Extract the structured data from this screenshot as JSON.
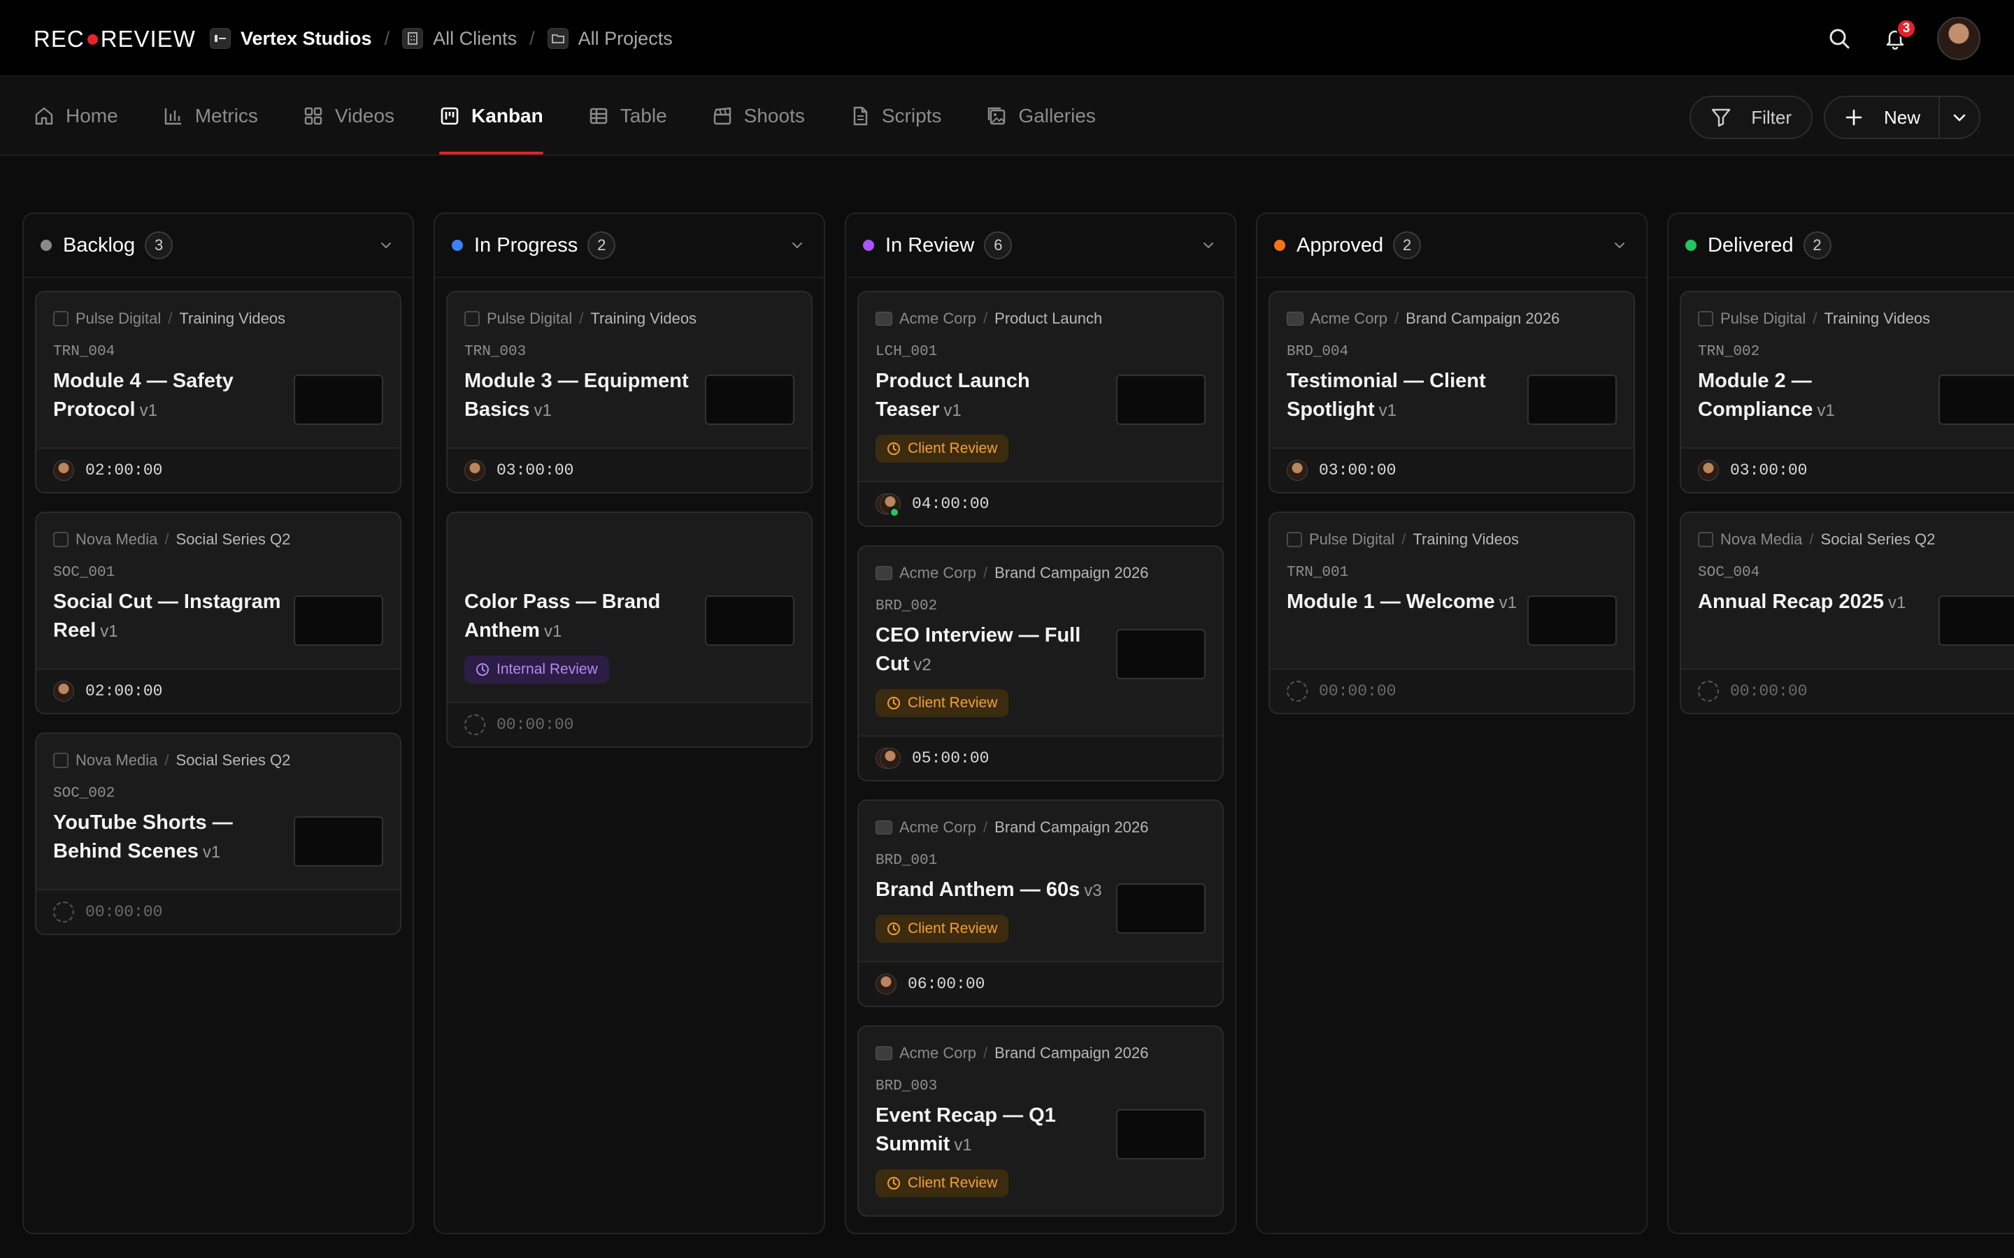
{
  "app": {
    "logo_left": "REC",
    "logo_right": "REVIEW",
    "brand_red": "#e8232b",
    "breadcrumbs": [
      {
        "label": "Vertex Studios",
        "icon": "studio-icon"
      },
      {
        "label": "All Clients",
        "icon": "building-icon"
      },
      {
        "label": "All Projects",
        "icon": "folder-icon"
      }
    ],
    "notification_count": "3"
  },
  "nav": {
    "tabs": [
      {
        "label": "Home",
        "icon": "home-icon"
      },
      {
        "label": "Metrics",
        "icon": "bar-chart-icon"
      },
      {
        "label": "Videos",
        "icon": "grid-icon"
      },
      {
        "label": "Kanban",
        "icon": "kanban-icon",
        "active": true
      },
      {
        "label": "Table",
        "icon": "table-icon"
      },
      {
        "label": "Shoots",
        "icon": "clapperboard-icon"
      },
      {
        "label": "Scripts",
        "icon": "document-icon"
      },
      {
        "label": "Galleries",
        "icon": "gallery-icon"
      }
    ],
    "filter_label": "Filter",
    "new_label": "New"
  },
  "columns": [
    {
      "title": "Backlog",
      "count": "3",
      "color": "#8a8a8a",
      "cards": [
        {
          "client": "Pulse Digital",
          "project": "Training Videos",
          "code": "TRN_004",
          "title": "Module 4 — Safety Protocol",
          "version": "v1",
          "duration": "02:00:00",
          "assignee": "single"
        },
        {
          "client": "Nova Media",
          "project": "Social Series Q2",
          "code": "SOC_001",
          "title": "Social Cut — Instagram Reel",
          "version": "v1",
          "duration": "02:00:00",
          "assignee": "single"
        },
        {
          "client": "Nova Media",
          "project": "Social Series Q2",
          "code": "SOC_002",
          "title": "YouTube Shorts — Behind Scenes",
          "version": "v1",
          "duration": "00:00:00",
          "assignee": "none"
        }
      ]
    },
    {
      "title": "In Progress",
      "count": "2",
      "color": "#3b82f6",
      "cards": [
        {
          "client": "Pulse Digital",
          "project": "Training Videos",
          "code": "TRN_003",
          "title": "Module 3 — Equipment Basics",
          "version": "v1",
          "duration": "03:00:00",
          "assignee": "single"
        },
        {
          "client": "",
          "project": "",
          "code": "",
          "title": "Color Pass — Brand Anthem",
          "version": "v1",
          "status": "Internal Review",
          "status_kind": "internal",
          "duration": "00:00:00",
          "assignee": "none"
        }
      ]
    },
    {
      "title": "In Review",
      "count": "6",
      "color": "#a855f7",
      "cards": [
        {
          "client": "Acme Corp",
          "project": "Product Launch",
          "code": "LCH_001",
          "title": "Product Launch Teaser",
          "version": "v1",
          "status": "Client Review",
          "status_kind": "client",
          "duration": "04:00:00",
          "assignee": "pair-online",
          "logo": true
        },
        {
          "client": "Acme Corp",
          "project": "Brand Campaign 2026",
          "code": "BRD_002",
          "title": "CEO Interview — Full Cut",
          "version": "v2",
          "status": "Client Review",
          "status_kind": "client",
          "duration": "05:00:00",
          "assignee": "pair",
          "logo": true
        },
        {
          "client": "Acme Corp",
          "project": "Brand Campaign 2026",
          "code": "BRD_001",
          "title": "Brand Anthem — 60s",
          "version": "v3",
          "status": "Client Review",
          "status_kind": "client",
          "duration": "06:00:00",
          "assignee": "single",
          "logo": true
        },
        {
          "client": "Acme Corp",
          "project": "Brand Campaign 2026",
          "code": "BRD_003",
          "title": "Event Recap — Q1 Summit",
          "version": "v1",
          "status": "Client Review",
          "status_kind": "client",
          "duration": "",
          "assignee": "none",
          "logo": true
        }
      ]
    },
    {
      "title": "Approved",
      "count": "2",
      "color": "#f97316",
      "cards": [
        {
          "client": "Acme Corp",
          "project": "Brand Campaign 2026",
          "code": "BRD_004",
          "title": "Testimonial — Client Spotlight",
          "version": "v1",
          "duration": "03:00:00",
          "assignee": "single",
          "logo": true
        },
        {
          "client": "Pulse Digital",
          "project": "Training Videos",
          "code": "TRN_001",
          "title": "Module 1 — Welcome",
          "version": "v1",
          "duration": "00:00:00",
          "assignee": "none"
        }
      ]
    },
    {
      "title": "Delivered",
      "count": "2",
      "color": "#22c55e",
      "cards": [
        {
          "client": "Pulse Digital",
          "project": "Training Videos",
          "code": "TRN_002",
          "title": "Module 2 — Compliance",
          "version": "v1",
          "duration": "03:00:00",
          "assignee": "single"
        },
        {
          "client": "Nova Media",
          "project": "Social Series Q2",
          "code": "SOC_004",
          "title": "Annual Recap 2025",
          "version": "v1",
          "duration": "00:00:00",
          "assignee": "none"
        }
      ]
    }
  ]
}
